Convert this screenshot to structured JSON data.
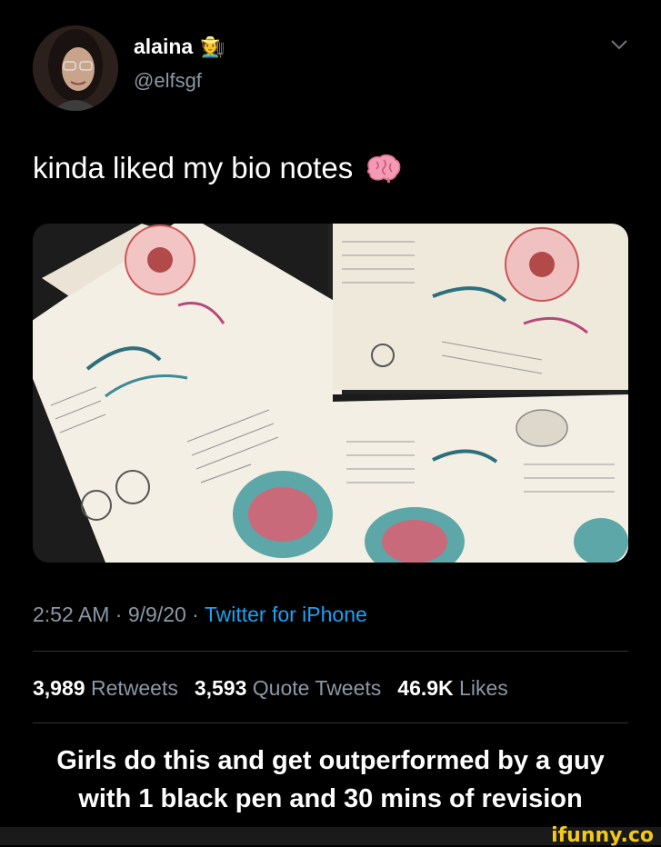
{
  "user": {
    "display_name": "alaina",
    "name_emoji": "🧑‍🌾",
    "handle": "@elfsgf"
  },
  "tweet": {
    "text": "kinda liked my bio notes",
    "text_emoji_icon": "brain-icon",
    "time": "2:52 AM",
    "date": "9/9/20",
    "source": "Twitter for iPhone",
    "separator": " · "
  },
  "stats": {
    "retweets_count": "3,989",
    "retweets_label": "Retweets",
    "quotes_count": "3,593",
    "quotes_label": "Quote Tweets",
    "likes_count": "46.9K",
    "likes_label": "Likes"
  },
  "caption": {
    "line1": "Girls do this and get outperformed by a guy",
    "line2": "with 1 black pen and 30 mins of revision"
  },
  "watermark": "ifunny.co",
  "colors": {
    "background": "#000000",
    "muted": "#8b98a5",
    "link": "#1da1f2",
    "watermark": "#f2c81c"
  }
}
